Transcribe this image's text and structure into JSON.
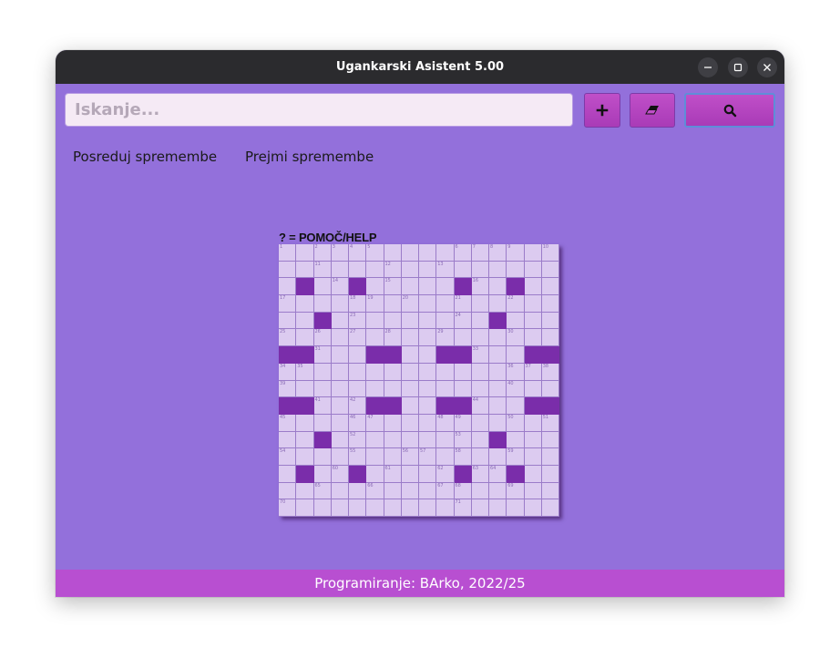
{
  "window": {
    "title": "Ugankarski Asistent 5.00",
    "controls": [
      "minimize-icon",
      "maximize-icon",
      "close-icon"
    ]
  },
  "toolbar": {
    "search_placeholder": "Iskanje...",
    "add_icon": "plus-icon",
    "clear_icon": "eraser-icon",
    "search_icon": "magnifier-icon"
  },
  "sync": {
    "send_label": "Posreduj spremembe",
    "receive_label": "Prejmi spremembe"
  },
  "puzzle": {
    "help_label": "? = POMOČ/HELP",
    "rows": [
      "................",
      "................",
      ".#..#.....#..#..",
      "................",
      "..#.........#...",
      "................",
      "##...##..##...##",
      "................",
      "................",
      "##...##..##...##",
      "................",
      "..#.........#...",
      "................",
      ".#..#.....#..#..",
      "................",
      "................"
    ],
    "numbers": [
      [
        0,
        0,
        "1"
      ],
      [
        0,
        2,
        "2"
      ],
      [
        0,
        3,
        "3"
      ],
      [
        0,
        4,
        "4"
      ],
      [
        0,
        5,
        "5"
      ],
      [
        0,
        10,
        "6"
      ],
      [
        0,
        11,
        "7"
      ],
      [
        0,
        12,
        "8"
      ],
      [
        0,
        13,
        "9"
      ],
      [
        0,
        15,
        "10"
      ],
      [
        1,
        2,
        "11"
      ],
      [
        1,
        6,
        "12"
      ],
      [
        1,
        9,
        "13"
      ],
      [
        2,
        3,
        "14"
      ],
      [
        2,
        6,
        "15"
      ],
      [
        2,
        11,
        "16"
      ],
      [
        3,
        0,
        "17"
      ],
      [
        3,
        4,
        "18"
      ],
      [
        3,
        5,
        "19"
      ],
      [
        3,
        7,
        "20"
      ],
      [
        3,
        10,
        "21"
      ],
      [
        3,
        13,
        "22"
      ],
      [
        4,
        4,
        "23"
      ],
      [
        4,
        10,
        "24"
      ],
      [
        5,
        0,
        "25"
      ],
      [
        5,
        2,
        "26"
      ],
      [
        5,
        4,
        "27"
      ],
      [
        5,
        6,
        "28"
      ],
      [
        5,
        9,
        "29"
      ],
      [
        5,
        13,
        "30"
      ],
      [
        6,
        2,
        "31"
      ],
      [
        6,
        6,
        "32"
      ],
      [
        6,
        11,
        "33"
      ],
      [
        7,
        0,
        "34"
      ],
      [
        7,
        1,
        "35"
      ],
      [
        7,
        13,
        "36"
      ],
      [
        7,
        14,
        "37"
      ],
      [
        7,
        15,
        "38"
      ],
      [
        8,
        0,
        "39"
      ],
      [
        8,
        13,
        "40"
      ],
      [
        9,
        2,
        "41"
      ],
      [
        9,
        4,
        "42"
      ],
      [
        9,
        6,
        "43"
      ],
      [
        9,
        11,
        "44"
      ],
      [
        10,
        0,
        "45"
      ],
      [
        10,
        4,
        "46"
      ],
      [
        10,
        5,
        "47"
      ],
      [
        10,
        9,
        "48"
      ],
      [
        10,
        10,
        "49"
      ],
      [
        10,
        13,
        "50"
      ],
      [
        10,
        15,
        "51"
      ],
      [
        11,
        4,
        "52"
      ],
      [
        11,
        10,
        "53"
      ],
      [
        12,
        0,
        "54"
      ],
      [
        12,
        4,
        "55"
      ],
      [
        12,
        7,
        "56"
      ],
      [
        12,
        8,
        "57"
      ],
      [
        12,
        10,
        "58"
      ],
      [
        12,
        13,
        "59"
      ],
      [
        13,
        3,
        "60"
      ],
      [
        13,
        6,
        "61"
      ],
      [
        13,
        9,
        "62"
      ],
      [
        13,
        11,
        "63"
      ],
      [
        13,
        12,
        "64"
      ],
      [
        14,
        2,
        "65"
      ],
      [
        14,
        5,
        "66"
      ],
      [
        14,
        9,
        "67"
      ],
      [
        14,
        10,
        "68"
      ],
      [
        14,
        13,
        "69"
      ],
      [
        15,
        0,
        "70"
      ],
      [
        15,
        10,
        "71"
      ]
    ]
  },
  "footer": {
    "credit": "Programiranje: BArko, 2022/25"
  }
}
